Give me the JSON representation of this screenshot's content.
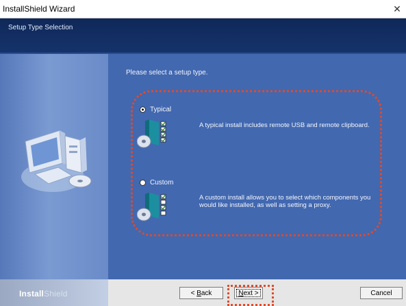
{
  "window": {
    "title": "InstallShield Wizard",
    "close_glyph": "✕"
  },
  "header": {
    "title": "Setup Type Selection"
  },
  "main": {
    "prompt": "Please select a setup type.",
    "options": [
      {
        "label": "Typical",
        "selected": true,
        "description": "A typical install includes remote USB and remote clipboard."
      },
      {
        "label": "Custom",
        "selected": false,
        "description": "A custom install allows you to select which components you would like installed, as well as setting a proxy."
      }
    ]
  },
  "footer": {
    "brand_bold": "Install",
    "brand_light": "Shield",
    "back_lt": "< ",
    "back_key": "B",
    "back_rest": "ack",
    "next_key": "N",
    "next_rest": "ext >",
    "cancel_label": "Cancel"
  },
  "colors": {
    "accent_highlight": "#e04a2a",
    "header_bg": "#0f2859",
    "content_bg": "#4268b0"
  },
  "icons": {
    "computer": "computer-cd-icon",
    "installer": "installer-package-icon"
  }
}
